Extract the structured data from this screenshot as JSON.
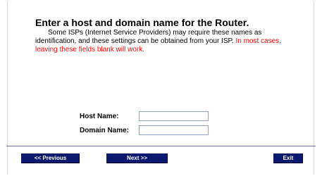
{
  "page": {
    "heading": "Enter a host and domain name for the Router.",
    "description": "Some ISPs (Internet Service Providers) may require these names as identification, and these settings can be obtained from your ISP.",
    "description_warning": "In most cases, leaving these fields blank will work."
  },
  "form": {
    "host_name_label": "Host Name:",
    "host_name_value": "",
    "domain_name_label": "Domain Name:",
    "domain_name_value": ""
  },
  "nav": {
    "previous_label": "<< Previous",
    "next_label": "Next >>",
    "exit_label": "Exit"
  },
  "colors": {
    "button_bg": "#0b1a6e",
    "warning_text": "#ff0000",
    "divider": "#6d6da8"
  }
}
